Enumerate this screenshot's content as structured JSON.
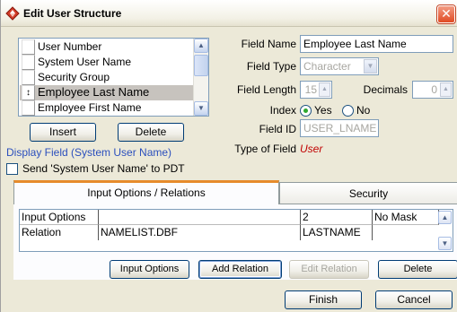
{
  "window": {
    "title": "Edit User Structure",
    "icon": "diamond-arrows-icon",
    "close_glyph": "✕"
  },
  "field_list": {
    "items": [
      {
        "label": "User Number",
        "marker": ""
      },
      {
        "label": "System User Name",
        "marker": ""
      },
      {
        "label": "Security Group",
        "marker": ""
      },
      {
        "label": "Employee Last Name",
        "marker": "↕",
        "selected": true
      },
      {
        "label": "Employee First Name",
        "marker": ""
      }
    ],
    "scroll_up": "▲",
    "scroll_down": "▼"
  },
  "buttons": {
    "insert": "Insert",
    "delete": "Delete"
  },
  "display_field": "Display Field (System User Name)",
  "send_checkbox": {
    "label": "Send 'System User Name' to PDT",
    "checked": false
  },
  "properties": {
    "field_name_label": "Field Name",
    "field_name_value": "Employee Last Name",
    "field_type_label": "Field Type",
    "field_type_value": "Character",
    "field_length_label": "Field Length",
    "field_length_value": "15",
    "decimals_label": "Decimals",
    "decimals_value": "0",
    "index_label": "Index",
    "index_yes": "Yes",
    "index_no": "No",
    "index_selected": "Yes",
    "field_id_label": "Field ID",
    "field_id_value": "USER_LNAME",
    "type_of_field_label": "Type of Field",
    "type_of_field_value": "User"
  },
  "tabs": [
    {
      "label": "Input Options / Relations",
      "active": true
    },
    {
      "label": "Security",
      "active": false
    }
  ],
  "options_grid": {
    "headers": [
      "Input Options",
      "",
      "2",
      "No Mask"
    ],
    "rows": [
      [
        "Relation",
        "NAMELIST.DBF",
        "LASTNAME",
        ""
      ]
    ]
  },
  "panel_buttons": {
    "input_options": "Input Options",
    "add_relation": "Add Relation",
    "edit_relation": "Edit Relation",
    "delete": "Delete"
  },
  "footer": {
    "finish": "Finish",
    "cancel": "Cancel"
  },
  "colors": {
    "accent_tab": "#e68b2c",
    "link_blue": "#2b4fbd",
    "user_red": "#c00000",
    "window_bg": "#ece9d8"
  }
}
